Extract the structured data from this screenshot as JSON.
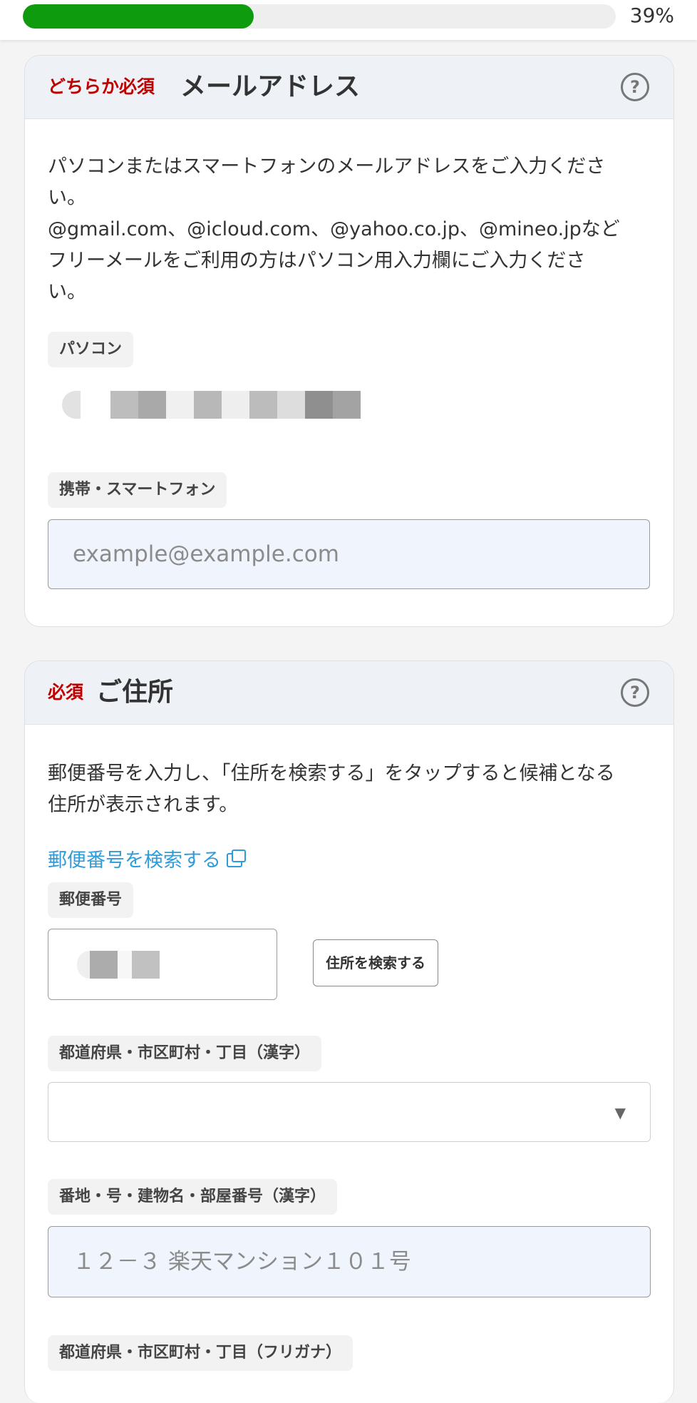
{
  "progress": {
    "percent_label": "39%",
    "value": 0.39,
    "fill_color": "#0e9b0e"
  },
  "email": {
    "required_label": "どちらか必須",
    "title": "メールアドレス",
    "help_icon": "question-circle-icon",
    "desc_lines": [
      "パソコンまたはスマートフォンのメールアドレスをご入力くださ",
      "い。",
      "@gmail.com、@icloud.com、@yahoo.co.jp、@mineo.jpなど",
      "フリーメールをご利用の方はパソコン用入力欄にご入力くださ",
      "い。"
    ],
    "pc_label": "パソコン",
    "mobile_label": "携帯・スマートフォン",
    "mobile_placeholder": "example@example.com"
  },
  "address": {
    "required_label": "必須",
    "title": "ご住所",
    "help_icon": "question-circle-icon",
    "desc_lines": [
      "郵便番号を入力し、「住所を検索する」をタップすると候補となる",
      "住所が表示されます。"
    ],
    "postal_search_link": "郵便番号を検索する",
    "postal_label": "郵便番号",
    "search_button": "住所を検索する",
    "pref_label": "都道府県・市区町村・丁目（漢字）",
    "street_label": "番地・号・建物名・部屋番号（漢字）",
    "street_placeholder": "１２－３ 楽天マンション１０１号",
    "kana_label": "都道府県・市区町村・丁目（フリガナ）"
  },
  "colors": {
    "required_red": "#bf0000",
    "link_blue": "#2f9cd9",
    "input_bg": "#eff4fd"
  }
}
